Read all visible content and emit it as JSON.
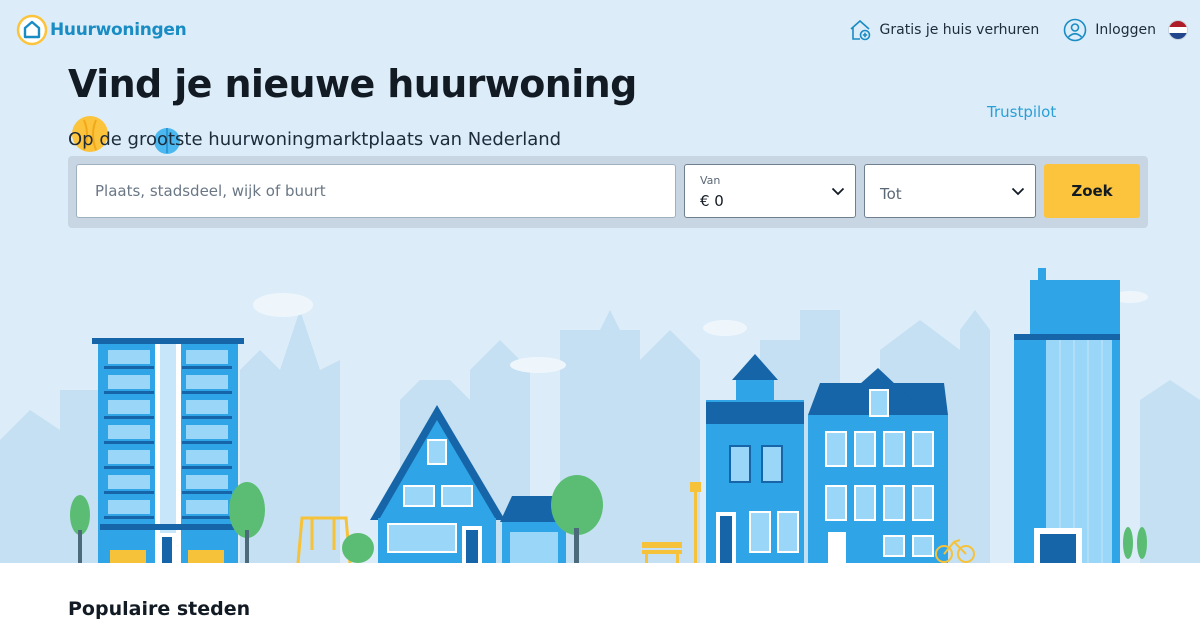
{
  "header": {
    "logo_text": "Huurwoningen",
    "nav_rent_out": "Gratis je huis verhuren",
    "nav_login": "Inloggen"
  },
  "hero": {
    "title": "Vind je nieuwe huurwoning",
    "subtitle": "Op de grootste huurwoningmarktplaats van Nederland",
    "trustpilot": "Trustpilot"
  },
  "search": {
    "placeholder": "Plaats, stadsdeel, wijk of buurt",
    "price_from_label": "Van",
    "price_from_value": "€ 0",
    "price_to_placeholder": "Tot",
    "submit_label": "Zoek"
  },
  "sections": {
    "popular_cities": "Populaire steden"
  },
  "colors": {
    "brand": "#1a8cc4",
    "accent": "#fcc33c",
    "hero_bg": "#dcedf9",
    "text": "#121a24"
  },
  "icons": {
    "logo": "house-logo-icon",
    "rent_out": "house-plus-icon",
    "login": "user-circle-icon",
    "language": "netherlands-flag-icon",
    "dropdown": "chevron-down-icon"
  }
}
